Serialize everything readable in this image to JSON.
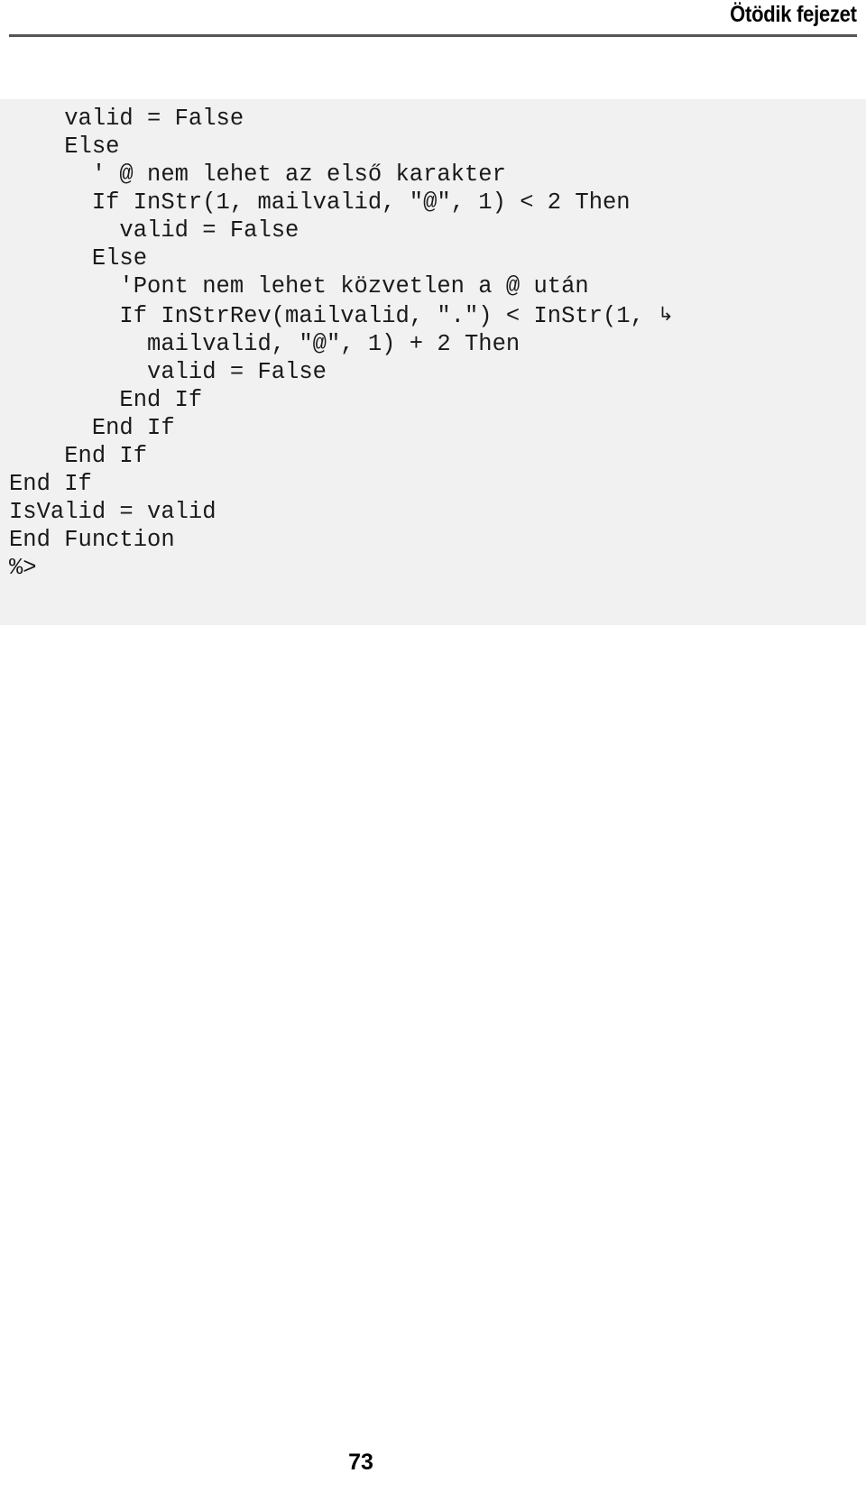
{
  "document": {
    "header": {
      "title": "Ötödik fejezet",
      "rule_color": "#555555"
    },
    "folio": {
      "page_number": "73"
    },
    "code_block": {
      "background_color": "#f1f1f1",
      "text_color": "#1a1a1a",
      "language": "VBScript / ASP",
      "continuation_glyph": "↳",
      "lines": [
        "    valid = False",
        "    Else",
        "      ' @ nem lehet az első karakter",
        "      If InStr(1, mailvalid, \"@\", 1) < 2 Then",
        "        valid = False",
        "      Else",
        "        'Pont nem lehet közvetlen a @ után",
        "        If InStrRev(mailvalid, \".\") < InStr(1, ",
        "          mailvalid, \"@\", 1) + 2 Then",
        "          valid = False",
        "        End If",
        "      End If",
        "    End If",
        "End If",
        "IsValid = valid",
        "End Function",
        "%>"
      ],
      "continuation_line_index": 7
    }
  }
}
